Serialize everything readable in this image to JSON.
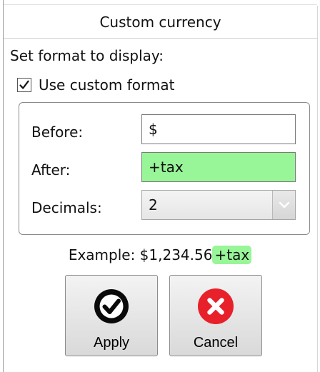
{
  "dialog": {
    "title": "Custom currency",
    "prompt": "Set format to display:"
  },
  "options": {
    "use_custom_format": {
      "label": "Use custom format",
      "checked": true
    }
  },
  "fields": {
    "before": {
      "label": "Before:",
      "value": "$"
    },
    "after": {
      "label": "After:",
      "value": "+tax",
      "highlight_color": "#98f598"
    },
    "decimals": {
      "label": "Decimals:",
      "value": "2"
    }
  },
  "example": {
    "prefix": "Example: $1,234.56",
    "suffix": "+tax"
  },
  "buttons": {
    "apply": {
      "label": "Apply",
      "icon": "check-circle-icon"
    },
    "cancel": {
      "label": "Cancel",
      "icon": "cancel-x-icon",
      "icon_color": "#e8202a"
    }
  }
}
